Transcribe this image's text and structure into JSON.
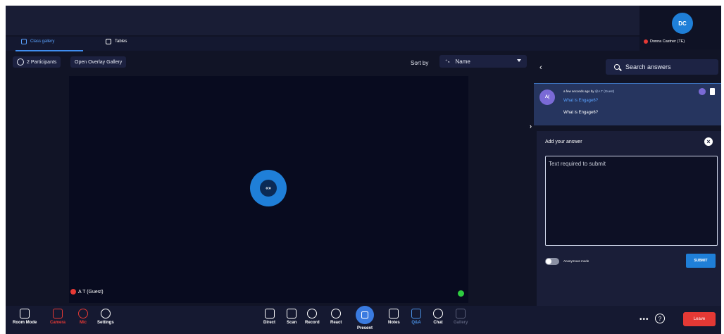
{
  "self_tile": {
    "initials": "DC",
    "name": "Donna Castner (TE)"
  },
  "tabs": [
    {
      "label": "Class gallery"
    },
    {
      "label": "Tables"
    }
  ],
  "toolbar": {
    "participants_label": "2 Participants",
    "overlay_label": "Open Overlay Gallery",
    "sort_label": "Sort by",
    "sort_icon": "⁺ₙ",
    "sort_value": "Name"
  },
  "stage": {
    "avatar_initials": "«»",
    "participant_name": "A T (Guest)"
  },
  "qa_panel": {
    "search_placeholder": "Search answers",
    "question": {
      "avatar_initials": "A(",
      "meta_time": "a few seconds ago",
      "meta_by": " by ",
      "meta_author": "@A T (Guest)",
      "title": "What is Engage6?",
      "body": "What is Engage6?"
    },
    "answer": {
      "title": "Add your answer",
      "placeholder": "Text required to submit",
      "anonymous_label": "Anonymous mode",
      "submit_label": "SUBMIT"
    }
  },
  "bottom_bar": {
    "left": [
      {
        "label": "Room Mode"
      },
      {
        "label": "Camera"
      },
      {
        "label": "Mic"
      },
      {
        "label": "Settings"
      }
    ],
    "center": [
      {
        "label": "Direct"
      },
      {
        "label": "Scan"
      },
      {
        "label": "Record"
      },
      {
        "label": "React"
      },
      {
        "label": "Present"
      },
      {
        "label": "Notes"
      },
      {
        "label": "Q&A"
      },
      {
        "label": "Chat"
      },
      {
        "label": "Gallery"
      }
    ],
    "more_label": "•••",
    "help_label": "?",
    "leave_label": "Leave"
  },
  "colors": {
    "background": "#111426",
    "accent_blue": "#1f7fd8",
    "danger_red": "#e53935",
    "online_green": "#2ecc40"
  }
}
